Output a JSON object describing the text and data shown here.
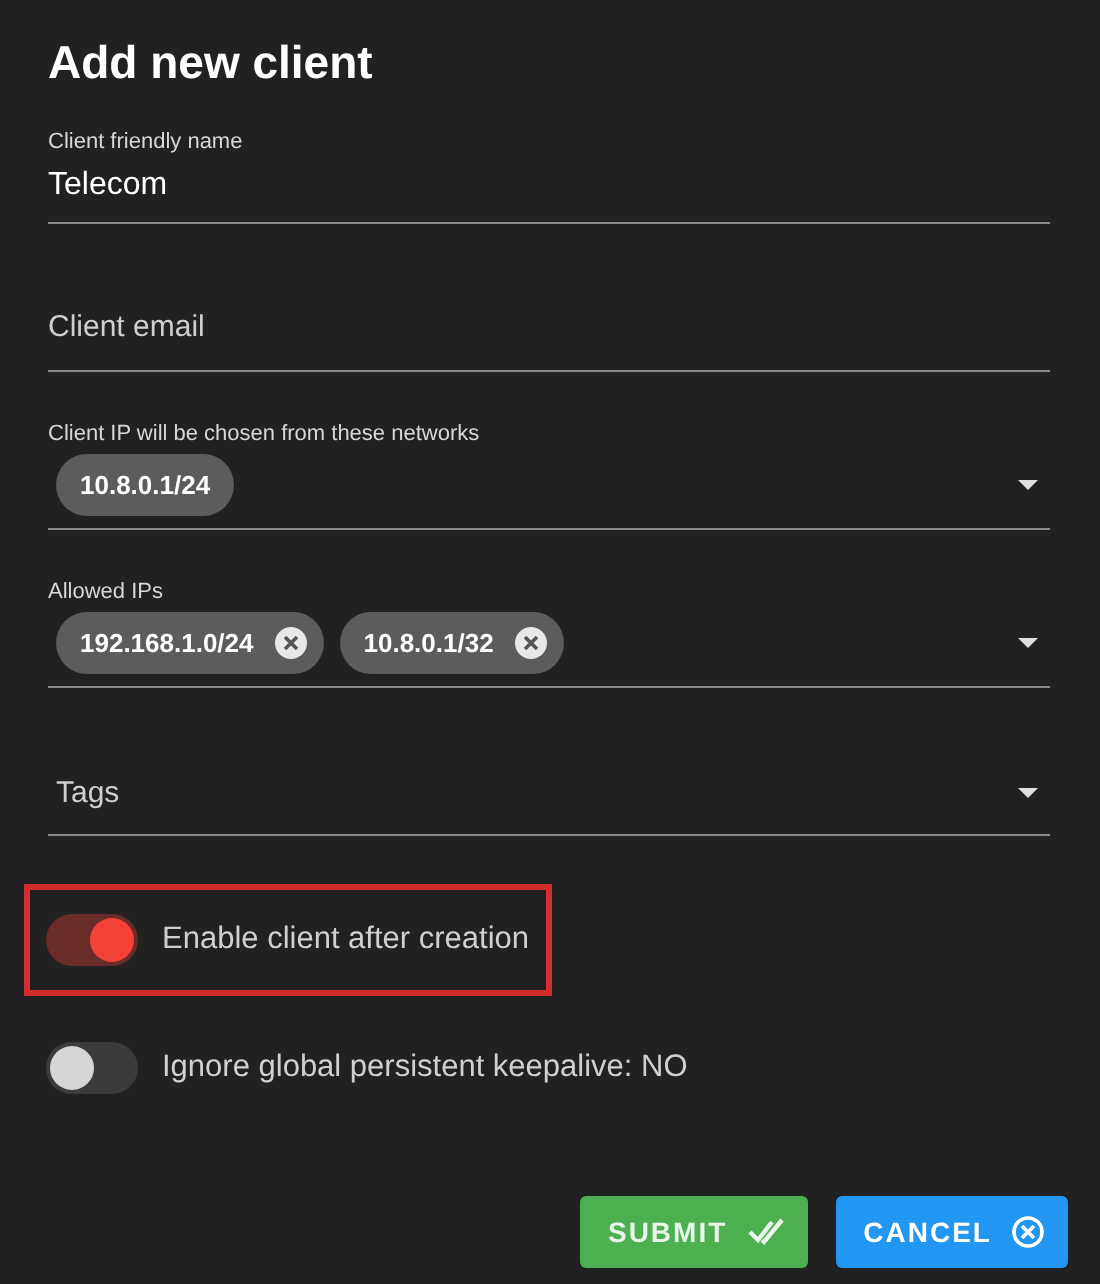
{
  "title": "Add new client",
  "fields": [
    {
      "kind": "text",
      "label": "Client friendly name",
      "value": "Telecom"
    },
    {
      "kind": "text",
      "placeholder": "Client email"
    },
    {
      "kind": "select",
      "label": "Client IP will be chosen from these networks",
      "chips": [
        {
          "text": "10.8.0.1/24",
          "removable": false
        }
      ]
    },
    {
      "kind": "select",
      "label": "Allowed IPs",
      "chips": [
        {
          "text": "192.168.1.0/24",
          "removable": true
        },
        {
          "text": "10.8.0.1/32",
          "removable": true
        }
      ]
    },
    {
      "kind": "select",
      "placeholder": "Tags"
    }
  ],
  "switches": [
    {
      "label": "Enable client after creation",
      "on": true,
      "highlighted": true
    },
    {
      "label": "Ignore global persistent keepalive: NO",
      "on": false,
      "highlighted": false
    }
  ],
  "buttons": [
    {
      "kind": "submit",
      "label": "SUBMIT"
    },
    {
      "kind": "cancel",
      "label": "CANCEL"
    }
  ]
}
